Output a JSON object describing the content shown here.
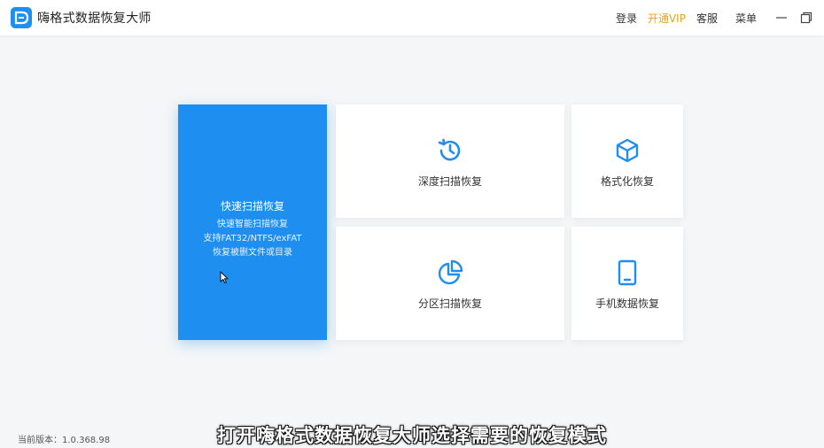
{
  "app": {
    "title": "嗨格式数据恢复大师"
  },
  "header": {
    "login": "登录",
    "vip": "开通VIP",
    "service": "客服",
    "menu": "菜单"
  },
  "cards": {
    "quick": {
      "title": "快速扫描恢复",
      "desc1": "快速智能扫描恢复",
      "desc2": "支持FAT32/NTFS/exFAT",
      "desc3": "恢复被删文件或目录"
    },
    "deep": {
      "label": "深度扫描恢复",
      "icon": "history-icon"
    },
    "format": {
      "label": "格式化恢复",
      "icon": "cube-icon"
    },
    "partition": {
      "label": "分区扫描恢复",
      "icon": "pie-chart-icon"
    },
    "phone": {
      "label": "手机数据恢复",
      "icon": "tablet-icon"
    }
  },
  "footer": {
    "version": "当前版本：1.0.368.98"
  },
  "overlay": {
    "subtitle": "打开嗨格式数据恢复大师选择需要的恢复模式"
  },
  "colors": {
    "accent": "#1e8ef0",
    "vip": "#f0a020",
    "background": "#f5f6f7"
  }
}
